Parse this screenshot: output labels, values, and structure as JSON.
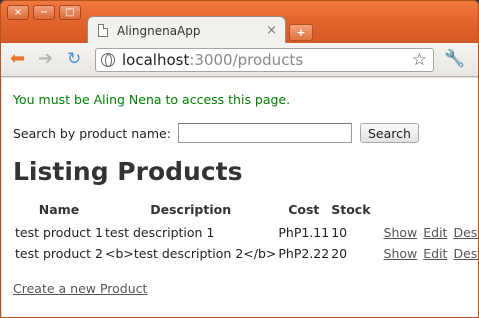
{
  "browser": {
    "tab_title": "AlingnenaApp",
    "tab_close": "×",
    "new_tab": "+",
    "url_host": "localhost",
    "url_path": ":3000/products",
    "window_controls": [
      "×",
      "−",
      "□"
    ]
  },
  "page": {
    "notice": "You must be Aling Nena to access this page.",
    "search": {
      "label": "Search by product name:",
      "value": "",
      "button": "Search"
    },
    "heading": "Listing Products",
    "table": {
      "headers": [
        "Name",
        "Description",
        "Cost",
        "Stock"
      ],
      "rows": [
        {
          "name": "test product 1",
          "description": "test description 1",
          "cost": "PhP1.11",
          "stock": "10",
          "show": "Show",
          "edit": "Edit",
          "destroy": "Destroy"
        },
        {
          "name": "test product 2",
          "description": "<b>test description 2</b>",
          "cost": "PhP2.22",
          "stock": "20",
          "show": "Show",
          "edit": "Edit",
          "destroy": "Destroy"
        }
      ]
    },
    "create_link": "Create a new Product"
  },
  "colors": {
    "titlebar": "#e0602a",
    "notice": "#008000",
    "link": "#555555"
  }
}
